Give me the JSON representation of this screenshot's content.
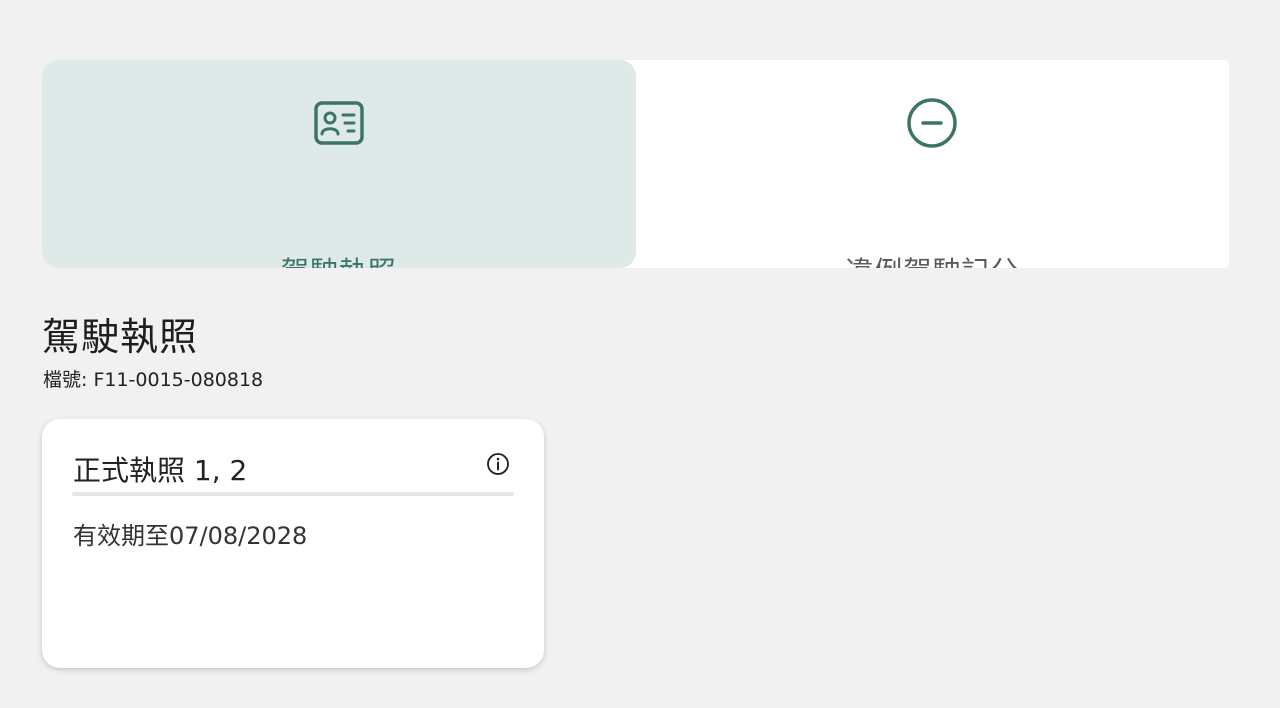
{
  "tabs": [
    {
      "label": "駕駛執照",
      "icon": "id-card-icon",
      "active": true
    },
    {
      "label": "違例駕駛記分",
      "icon": "minus-circle-icon",
      "active": false
    }
  ],
  "page": {
    "title": "駕駛執照",
    "file_number": "檔號: F11-0015-080818"
  },
  "card": {
    "title": "正式執照 1, 2",
    "valid_until": "有效期至07/08/2028",
    "info_icon": "info-icon"
  },
  "colors": {
    "accent": "#3c7468",
    "active_tab_bg": "#ddeae8",
    "page_bg": "#f1f1f1"
  }
}
